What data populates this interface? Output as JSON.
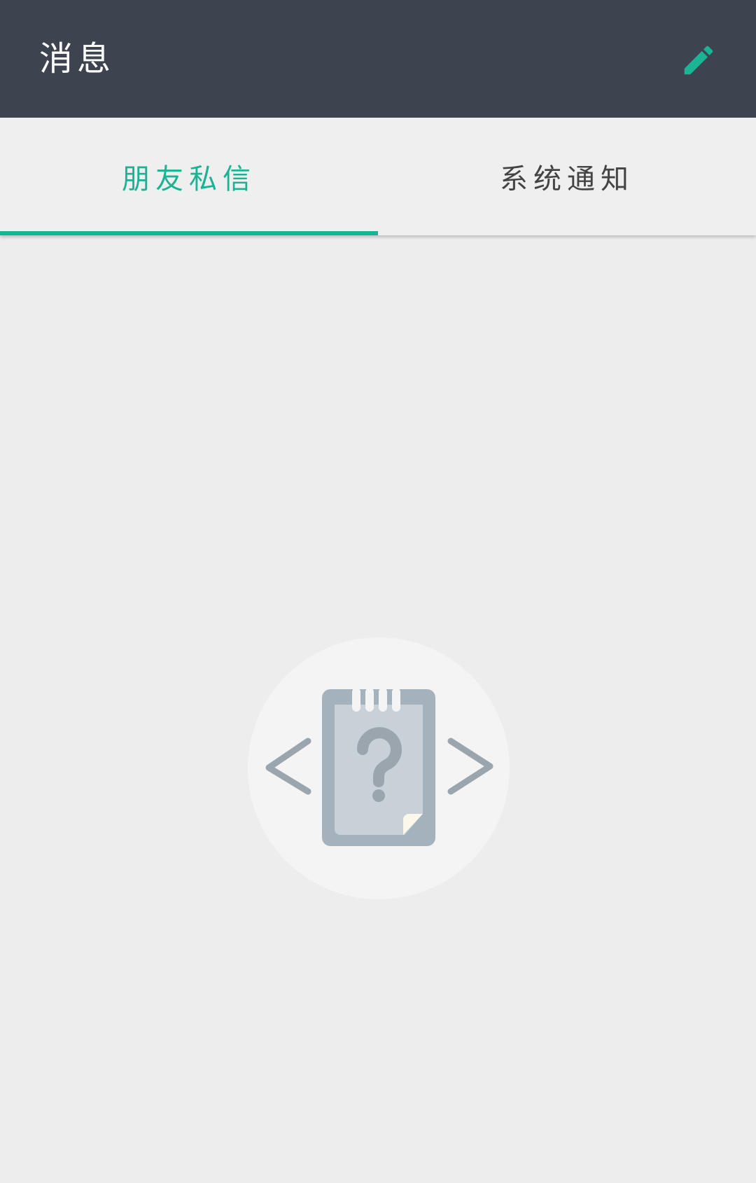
{
  "header": {
    "title": "消息",
    "edit_icon": "pencil-icon",
    "edit_color": "#1ab394"
  },
  "tabs": [
    {
      "label": "朋友私信",
      "active": true
    },
    {
      "label": "系统通知",
      "active": false
    }
  ],
  "colors": {
    "header_bg": "#3d444f",
    "accent": "#1ab394",
    "page_bg": "#ededed"
  },
  "empty_state": {
    "icon": "empty-document-question-icon"
  }
}
